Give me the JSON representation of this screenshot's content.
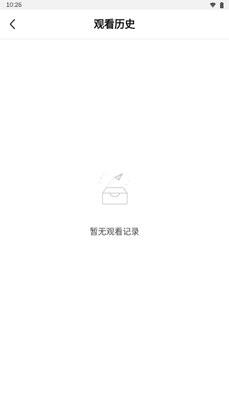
{
  "status_bar": {
    "time": "10:26",
    "icons": [
      "wifi-icon",
      "battery-icon"
    ]
  },
  "header": {
    "back_icon": "back-arrow-icon",
    "title": "观看历史"
  },
  "empty_state": {
    "icon": "empty-inbox-icon",
    "message": "暂无观看记录"
  }
}
